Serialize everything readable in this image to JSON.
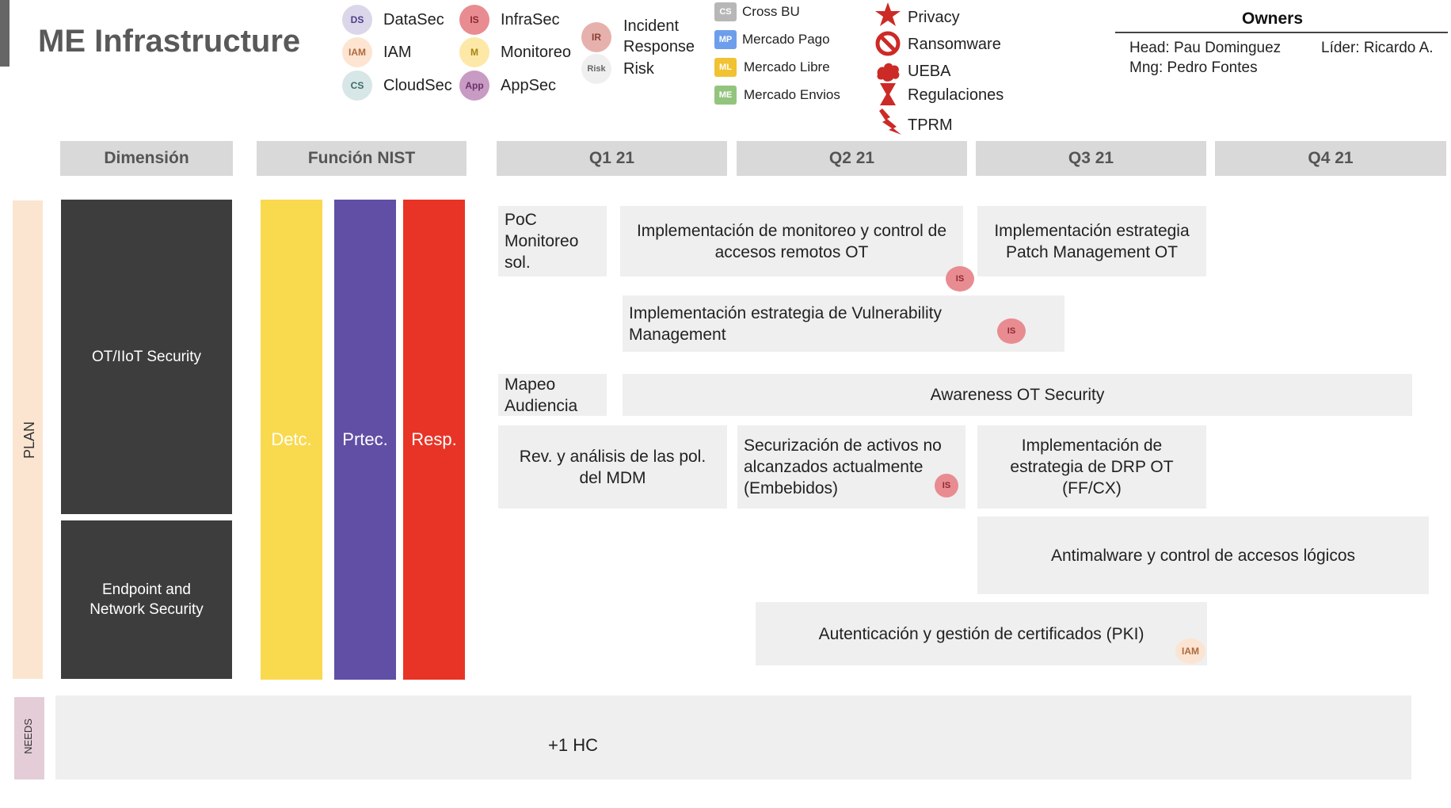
{
  "title": "ME Infrastructure",
  "legend": {
    "teams": [
      {
        "badge": "DS",
        "label": "DataSec",
        "color": "#dcd6ea"
      },
      {
        "badge": "IAM",
        "label": "IAM",
        "color": "#fde5d2"
      },
      {
        "badge": "CS",
        "label": "CloudSec",
        "color": "#d7e6e6"
      },
      {
        "badge": "IS",
        "label": "InfraSec",
        "color": "#e88c91"
      },
      {
        "badge": "M",
        "label": "Monitoreo",
        "color": "#fde8a7"
      },
      {
        "badge": "App",
        "label": "AppSec",
        "color": "#c79bc3"
      },
      {
        "badge": "IR",
        "label_line1": "Incident",
        "label_line2": "Response",
        "color": "#e6b1ac"
      },
      {
        "badge": "Risk",
        "label": "Risk",
        "color": "#efefef"
      }
    ],
    "bus": [
      {
        "badge": "CS",
        "label": "Cross BU",
        "color": "#b7b7b7"
      },
      {
        "badge": "MP",
        "label": "Mercado Pago",
        "color": "#6d9eeb"
      },
      {
        "badge": "ML",
        "label": "Mercado Libre",
        "color": "#f1c232"
      },
      {
        "badge": "ME",
        "label": "Mercado Envios",
        "color": "#93c47d"
      }
    ],
    "risks": [
      {
        "icon": "star-icon",
        "label": "Privacy"
      },
      {
        "icon": "no-entry-icon",
        "label": "Ransomware"
      },
      {
        "icon": "cloud-burst-icon",
        "label": "UEBA"
      },
      {
        "icon": "hourglass-icon",
        "label": "Regulaciones"
      },
      {
        "icon": "lightning-icon",
        "label": "TPRM"
      }
    ]
  },
  "owners": {
    "title": "Owners",
    "head": "Head: Pau Dominguez",
    "mng": "Mng: Pedro Fontes",
    "lider": "Líder:  Ricardo A."
  },
  "headers": {
    "dimension": "Dimensión",
    "nist": "Función NIST",
    "q1": "Q1 21",
    "q2": "Q2 21",
    "q3": "Q3 21",
    "q4": "Q4 21"
  },
  "plan_label": "PLAN",
  "needs_label": "NEEDS",
  "dimensions": {
    "ot": "OT/IIoT Security",
    "endpoint_line1": "Endpoint and",
    "endpoint_line2": "Network Security"
  },
  "nist": {
    "detect": "Detc.",
    "protect": "Prtec.",
    "respond": "Resp."
  },
  "tasks": {
    "poc": "PoC Monitoreo sol.",
    "remote_access": "Implementación de monitoreo y control de accesos remotos OT",
    "patch": "Implementación estrategia Patch Management OT",
    "vuln": "Implementación estrategia de Vulnerability Management",
    "mapeo": "Mapeo Audiencia",
    "awareness": "Awareness OT Security",
    "mdm": "Rev. y análisis de las pol. del MDM",
    "embedded": "Securización de activos no alcanzados actualmente (Embebidos)",
    "drp": "Implementación de estrategia de DRP OT (FF/CX)",
    "antimalware": "Antimalware y control de accesos lógicos",
    "pki": "Autenticación  y gestión de certificados (PKI)"
  },
  "tags": {
    "is": "IS",
    "iam": "IAM"
  },
  "needs": "+1 HC",
  "colors": {
    "detect": "#f9d94e",
    "protect": "#604fa4",
    "respond": "#e83426",
    "dimension": "#3d3d3d",
    "accent_red": "#cc2a26"
  }
}
